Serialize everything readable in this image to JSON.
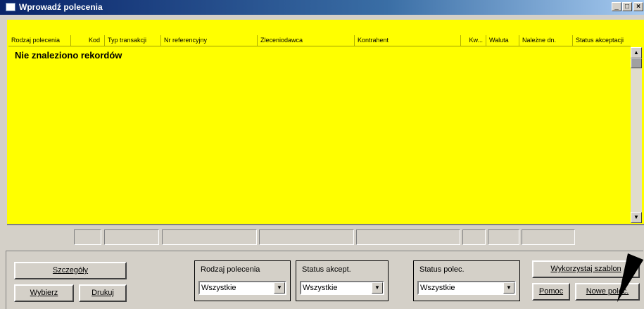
{
  "window": {
    "title": "Wprowadź polecenia",
    "minimize_icon": "_",
    "maximize_icon": "□",
    "close_icon": "×"
  },
  "table": {
    "columns": [
      "Rodzaj polecenia",
      "Kod",
      "Typ transakcji",
      "Nr referencyjny",
      "Zleceniodawca",
      "Kontrahent",
      "Kw...",
      "Waluta",
      "Należne dn.",
      "Status akceptacji"
    ],
    "empty_message": "Nie znaleziono rekordów"
  },
  "scrollbar": {
    "up_icon": "▲",
    "down_icon": "▼"
  },
  "buttons": {
    "szczegoly": "Szczegóły",
    "wybierz": "Wybierz",
    "drukuj": "Drukuj",
    "wykorzystaj_szablon": "Wykorzystaj szablon",
    "pomoc": "Pomoc",
    "nowe_polec": "Nowe polec."
  },
  "filters": [
    {
      "label": "Rodzaj polecenia",
      "value": "Wszystkie"
    },
    {
      "label": "Status akcept.",
      "value": "Wszystkie"
    },
    {
      "label": "Status polec.",
      "value": "Wszystkie"
    }
  ],
  "combo_arrow": "▼",
  "colors": {
    "grid_background": "#ffff00",
    "titlebar": "#0a246a",
    "window": "#d4d0c8"
  }
}
